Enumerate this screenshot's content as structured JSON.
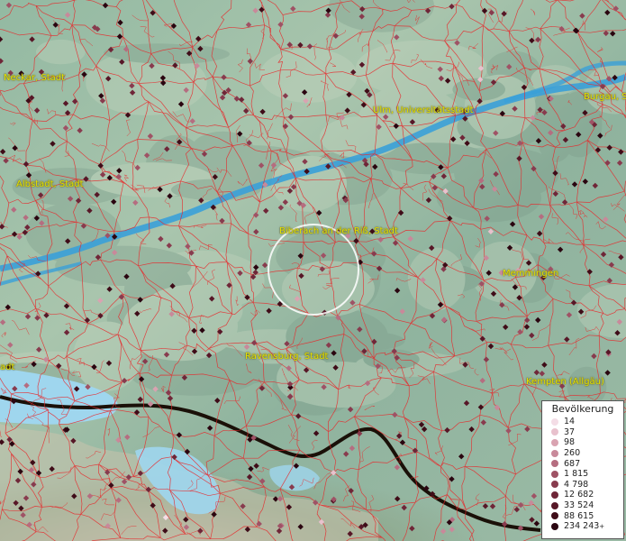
{
  "cities": [
    {
      "id": "neckar",
      "label": "Neckar, Stadt"
    },
    {
      "id": "burgau",
      "label": "Burgau, S"
    },
    {
      "id": "ulm",
      "label": "Ulm, Universitätsstadt"
    },
    {
      "id": "albstadt",
      "label": "Albstadt, Stadt"
    },
    {
      "id": "biberach",
      "label": "Biberach an der Riß, Stadt"
    },
    {
      "id": "memmingen",
      "label": "Memmingen"
    },
    {
      "id": "ravensburg",
      "label": "Ravensburg, Stadt"
    },
    {
      "id": "stadt_left",
      "label": "adt"
    },
    {
      "id": "kempten",
      "label": "Kempten (Allgäu)"
    }
  ],
  "legend": {
    "title": "Bevölkerung",
    "items": [
      {
        "label": "14",
        "color": "#f4dde6"
      },
      {
        "label": "37",
        "color": "#e8c1cd"
      },
      {
        "label": "98",
        "color": "#d9a3b1"
      },
      {
        "label": "260",
        "color": "#c8899a"
      },
      {
        "label": "687",
        "color": "#b56d80"
      },
      {
        "label": "1 815",
        "color": "#9f5265"
      },
      {
        "label": "4 798",
        "color": "#883b4e"
      },
      {
        "label": "12 682",
        "color": "#6f2638"
      },
      {
        "label": "33 524",
        "color": "#571727"
      },
      {
        "label": "88 615",
        "color": "#3f0c18"
      },
      {
        "label": "234 243",
        "color": "#2a0510",
        "plus": "+"
      }
    ]
  },
  "colors": {
    "boundary": "#e8272a",
    "river": "#3aa0d8",
    "lake": "#9fd6ee",
    "border": "#1a1008",
    "label": "#e6e200"
  }
}
